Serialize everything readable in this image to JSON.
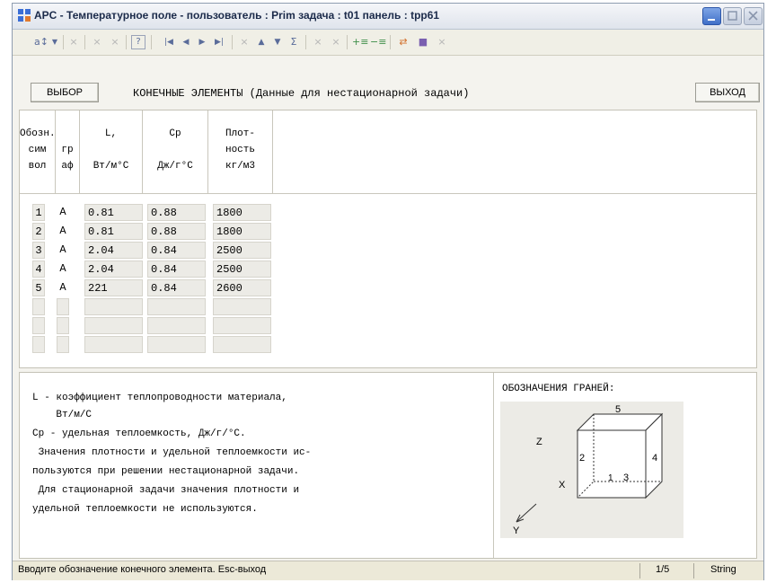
{
  "window": {
    "title": "APC - Температурное поле -  пользователь : Prim  задача : t01  панель : tpp61"
  },
  "toolbar": {
    "icons": [
      "sort-icon",
      "dropdown-icon",
      "delete-icon",
      "delete-icon",
      "delete-icon",
      "help-icon",
      "first-record-icon",
      "prev-record-icon",
      "next-record-icon",
      "last-record-icon",
      "delete-icon",
      "move-up-icon",
      "move-down-icon",
      "sum-icon",
      "delete-icon",
      "delete-icon",
      "insert-row-icon",
      "delete-row-icon",
      "transfer-icon",
      "save-icon",
      "delete-icon"
    ],
    "help_label": "?"
  },
  "buttons": {
    "select": "ВЫБОР",
    "exit": "ВЫХОД"
  },
  "heading": "КОНЕЧНЫЕ ЭЛЕМЕНТЫ (Данные для нестационарной задачи)",
  "table": {
    "headers": [
      {
        "lines": "Обозн.\nсим\nвол"
      },
      {
        "lines": "\nгр\nаф"
      },
      {
        "lines": "L,\n\nВт/м°С"
      },
      {
        "lines": "Cp\n\nДж/г°С"
      },
      {
        "lines": "Плот-\nность\nкг/м3"
      }
    ],
    "rows": [
      {
        "symbol": "1",
        "graph": "A",
        "L": "0.81",
        "Cp": "0.88",
        "density": "1800"
      },
      {
        "symbol": "2",
        "graph": "A",
        "L": "0.81",
        "Cp": "0.88",
        "density": "1800"
      },
      {
        "symbol": "3",
        "graph": "A",
        "L": "2.04",
        "Cp": "0.84",
        "density": "2500"
      },
      {
        "symbol": "4",
        "graph": "A",
        "L": "2.04",
        "Cp": "0.84",
        "density": "2500"
      },
      {
        "symbol": "5",
        "graph": "A",
        "L": "221",
        "Cp": "0.84",
        "density": "2600"
      },
      {
        "symbol": "",
        "graph": "",
        "L": "",
        "Cp": "",
        "density": ""
      },
      {
        "symbol": "",
        "graph": "",
        "L": "",
        "Cp": "",
        "density": ""
      },
      {
        "symbol": "",
        "graph": "",
        "L": "",
        "Cp": "",
        "density": ""
      }
    ]
  },
  "legend": {
    "lines": [
      "L - коэффициент теплопроводности материала,",
      "    Вт/м/С",
      "Cp - удельная теплоемкость, Дж/г/°С.",
      " Значения плотности и удельной теплоемкости ис-",
      "пользуются при решении нестационарной задачи.",
      " Для стационарной задачи значения плотности и",
      "удельной теплоемкости не используются."
    ]
  },
  "faces": {
    "title": "ОБОЗНАЧЕНИЯ ГРАНЕЙ:",
    "labels": {
      "top": "5",
      "left": "2",
      "right": "4",
      "front": "3",
      "back": "1"
    },
    "axes": {
      "z": "Z",
      "x": "X",
      "y": "Y"
    }
  },
  "status": {
    "message": "Вводите обозначение конечного элемента.  Esc-выход",
    "position": "1/5",
    "type": "String"
  },
  "colors": {
    "accent": "#3f6fc8",
    "toolbar_icon": "#5a6c9a",
    "cell_bg": "#ecebe6"
  }
}
